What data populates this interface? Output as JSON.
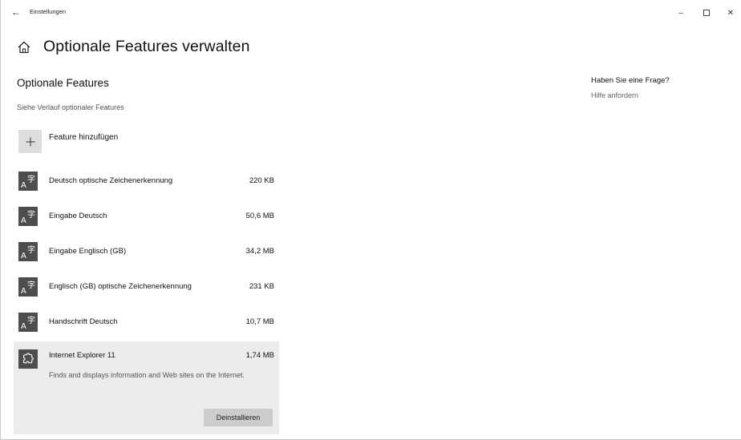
{
  "window": {
    "title": "Einstellungen",
    "back_glyph": "←",
    "minimize_glyph": "–",
    "close_glyph": "✕"
  },
  "header": {
    "title": "Optionale Features verwalten",
    "icon": "home-icon"
  },
  "section": {
    "title": "Optionale Features",
    "history_link": "Siehe Verlauf optionaler Features",
    "add_label": "Feature hinzufügen",
    "add_glyph": "+"
  },
  "features": [
    {
      "name": "Deutsch optische Zeichenerkennung",
      "size": "220 KB",
      "icon": "language-icon"
    },
    {
      "name": "Eingabe Deutsch",
      "size": "50,6 MB",
      "icon": "language-icon"
    },
    {
      "name": "Eingabe Englisch (GB)",
      "size": "34,2 MB",
      "icon": "language-icon"
    },
    {
      "name": "Englisch (GB) optische Zeichenerkennung",
      "size": "231 KB",
      "icon": "language-icon"
    },
    {
      "name": "Handschrift Deutsch",
      "size": "10,7 MB",
      "icon": "language-icon"
    },
    {
      "name": "Internet Explorer 11",
      "size": "1,74 MB",
      "icon": "puzzle-icon",
      "description": "Finds and displays information and Web sites on the Internet.",
      "button": "Deinstallieren",
      "selected": true
    }
  ],
  "aside": {
    "question": "Haben Sie eine Frage?",
    "help_link": "Hilfe anfordern"
  },
  "colors": {
    "icon_tile": "#4d4d4d",
    "selected_bg": "#ececec",
    "button_bg": "#cccccc",
    "add_tile": "#dddddd"
  }
}
